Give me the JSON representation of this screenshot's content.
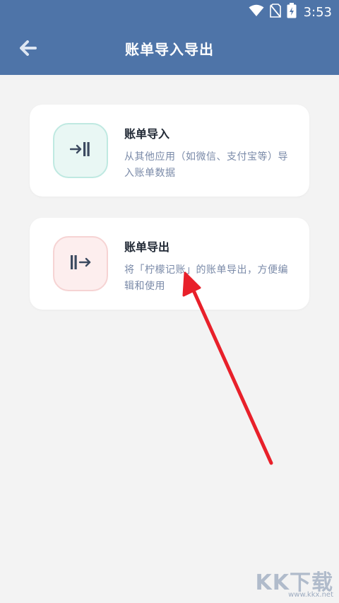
{
  "status_bar": {
    "time": "3:53",
    "icons": [
      "wifi-icon",
      "no-sim-icon",
      "battery-charging-icon"
    ]
  },
  "app_bar": {
    "title": "账单导入导出",
    "back_icon": "arrow-left-icon"
  },
  "cards": [
    {
      "title": "账单导入",
      "description": "从其他应用（如微信、支付宝等）导入账单数据",
      "icon": "import-icon"
    },
    {
      "title": "账单导出",
      "description": "将「柠檬记账」的账单导出，方便编辑和使用",
      "icon": "export-icon"
    }
  ],
  "annotation": {
    "type": "red-arrow",
    "color": "#e8202a"
  },
  "watermark": {
    "logo": "KK下载",
    "url": "www.kkx.net"
  },
  "colors": {
    "header": "#4e74a8",
    "background": "#f3f3f3",
    "import_icon_bg": "#e9f7f4",
    "export_icon_bg": "#fdeeee",
    "title_text": "#222a36",
    "desc_text": "#7a8aa8"
  }
}
